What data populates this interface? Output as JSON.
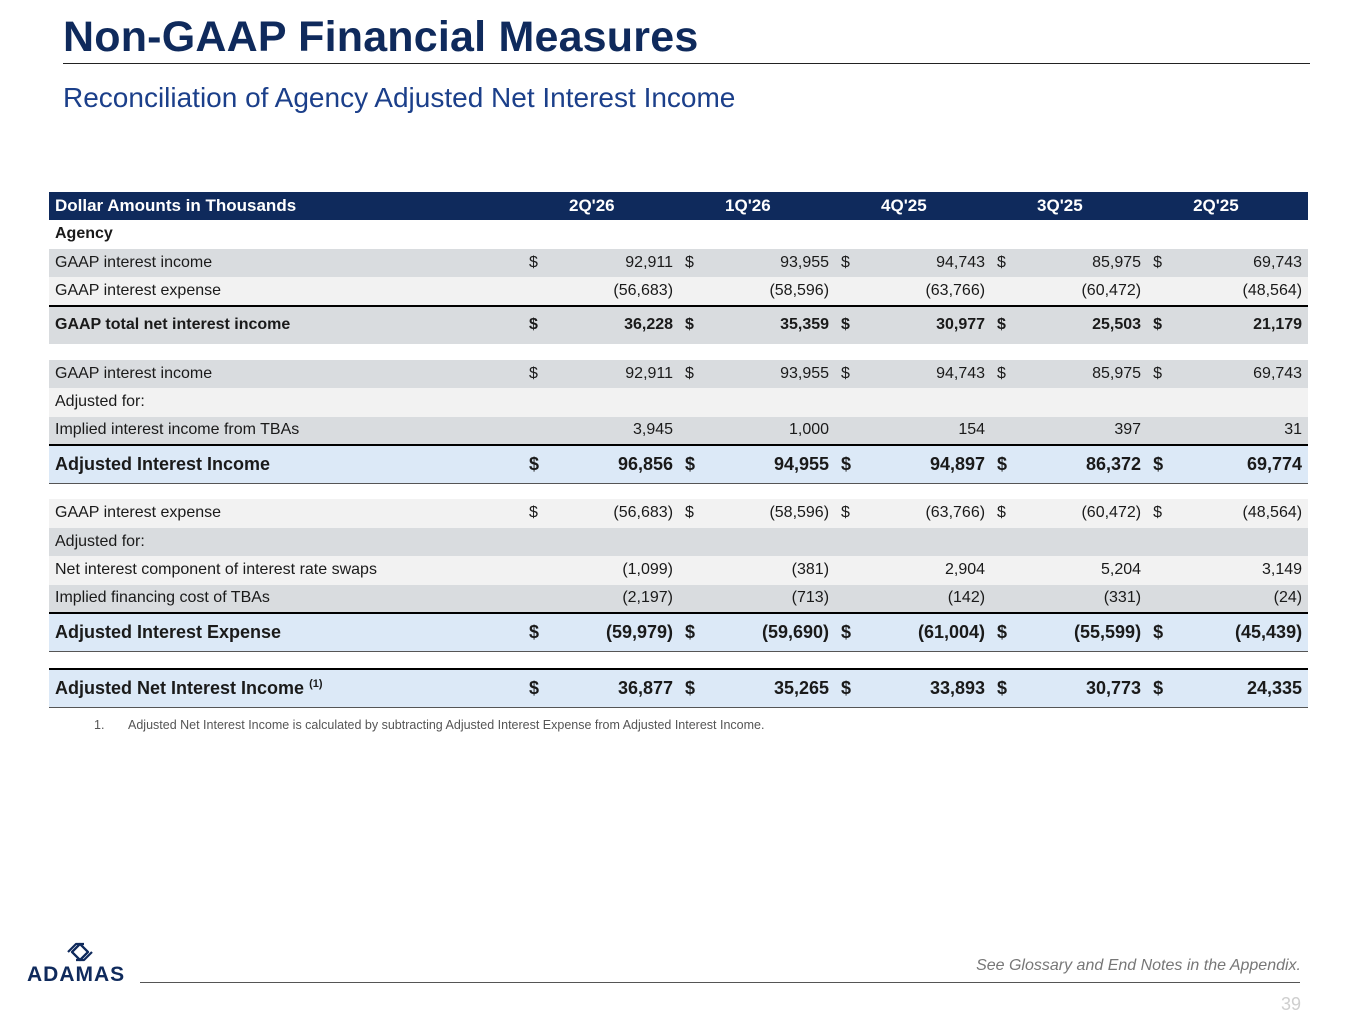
{
  "title": "Non-GAAP Financial Measures",
  "subtitle": "Reconciliation of Agency Adjusted Net Interest Income",
  "table": {
    "header_label": "Dollar Amounts in Thousands",
    "periods": [
      "2Q'26",
      "1Q'26",
      "4Q'25",
      "3Q'25",
      "2Q'25"
    ],
    "section_label": "Agency",
    "rows": [
      {
        "label": "GAAP interest income",
        "dollar": "$",
        "values": [
          "92,911",
          "93,955",
          "94,743",
          "85,975",
          "69,743"
        ]
      },
      {
        "label": "GAAP interest expense",
        "dollar": "",
        "values": [
          "(56,683)",
          "(58,596)",
          "(63,766)",
          "(60,472)",
          "(48,564)"
        ]
      },
      {
        "label": "GAAP total net interest income",
        "dollar": "$",
        "values": [
          "36,228",
          "35,359",
          "30,977",
          "25,503",
          "21,179"
        ]
      },
      {
        "label": "GAAP interest income",
        "dollar": "$",
        "values": [
          "92,911",
          "93,955",
          "94,743",
          "85,975",
          "69,743"
        ]
      },
      {
        "label": "Adjusted for:"
      },
      {
        "label": "Implied interest income from TBAs",
        "dollar": "",
        "values": [
          "3,945",
          "1,000",
          "154",
          "397",
          "31"
        ]
      },
      {
        "label": "Adjusted Interest Income",
        "dollar": "$",
        "values": [
          "96,856",
          "94,955",
          "94,897",
          "86,372",
          "69,774"
        ]
      },
      {
        "label": "GAAP interest expense",
        "dollar": "$",
        "values": [
          "(56,683)",
          "(58,596)",
          "(63,766)",
          "(60,472)",
          "(48,564)"
        ]
      },
      {
        "label": "Adjusted for:"
      },
      {
        "label": "Net interest component of interest rate swaps",
        "dollar": "",
        "values": [
          "(1,099)",
          "(381)",
          "2,904",
          "5,204",
          "3,149"
        ]
      },
      {
        "label": "Implied financing cost of TBAs",
        "dollar": "",
        "values": [
          "(2,197)",
          "(713)",
          "(142)",
          "(331)",
          "(24)"
        ]
      },
      {
        "label": "Adjusted Interest Expense",
        "dollar": "$",
        "values": [
          "(59,979)",
          "(59,690)",
          "(61,004)",
          "(55,599)",
          "(45,439)"
        ]
      },
      {
        "label": "Adjusted Net Interest Income",
        "footnote_ref": "(1)",
        "dollar": "$",
        "values": [
          "36,877",
          "35,265",
          "33,893",
          "30,773",
          "24,335"
        ]
      }
    ]
  },
  "footnote": {
    "number": "1.",
    "text": "Adjusted Net Interest Income is calculated by subtracting Adjusted Interest Expense from Adjusted Interest Income."
  },
  "logo_text": "ADAMAS",
  "glossary_note": "See Glossary and End Notes in the Appendix.",
  "page_number": "39"
}
